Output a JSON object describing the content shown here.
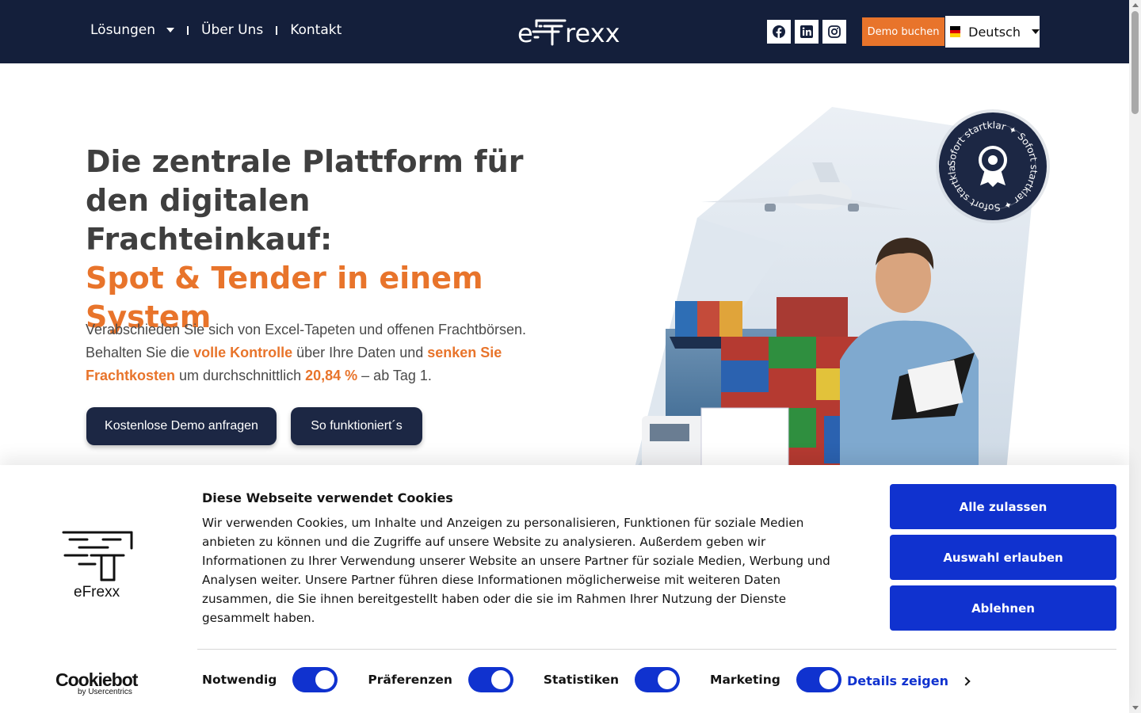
{
  "header": {
    "nav": [
      {
        "label": "Lösungen",
        "has_dropdown": true
      },
      {
        "label": "Über Uns"
      },
      {
        "label": "Kontakt"
      }
    ],
    "logo_text": "eFrexx",
    "socials": [
      "facebook-icon",
      "linkedin-icon",
      "instagram-icon"
    ],
    "demo_button": "Demo buchen",
    "language": {
      "label": "Deutsch",
      "flag": "de-flag"
    }
  },
  "hero": {
    "title_line1": "Die zentrale Plattform für den digitalen Frachteinkauf:",
    "title_accent": "Spot & Tender in einem System",
    "text_1": "Verabschieden Sie sich von Excel-Tapeten und offenen Frachtbörsen. Behalten Sie die ",
    "hl_1": "volle Kontrolle",
    "text_2": " über Ihre Daten und ",
    "hl_2": "senken Sie Frachtkosten",
    "text_3": " um durchschnittlich ",
    "hl_3": "20,84 %",
    "text_4": " – ab Tag 1.",
    "btn_demo": "Kostenlose Demo anfragen",
    "btn_how": "So funktioniert´s",
    "badge_text": "Sofort startklar ✦ Sofort startklar ✦ Sofort startklar ✦"
  },
  "cookie": {
    "logo_text": "eFrexx",
    "title": "Diese Webseite verwendet Cookies",
    "body": "Wir verwenden Cookies, um Inhalte und Anzeigen zu personalisieren, Funktionen für soziale Medien anbieten zu können und die Zugriffe auf unsere Website zu analysieren. Außerdem geben wir Informationen zu Ihrer Verwendung unserer Website an unsere Partner für soziale Medien, Werbung und Analysen weiter. Unsere Partner führen diese Informationen möglicherweise mit weiteren Daten zusammen, die Sie ihnen bereitgestellt haben oder die sie im Rahmen Ihrer Nutzung der Dienste gesammelt haben.",
    "btn_allow_all": "Alle zulassen",
    "btn_allow_selection": "Auswahl erlauben",
    "btn_deny": "Ablehnen",
    "toggles": [
      {
        "label": "Notwendig",
        "on": true
      },
      {
        "label": "Präferenzen",
        "on": true
      },
      {
        "label": "Statistiken",
        "on": true
      },
      {
        "label": "Marketing",
        "on": true
      }
    ],
    "details": "Details zeigen",
    "cookiebot": "Cookiebot",
    "cookiebot_sub": "by Usercentrics"
  },
  "colors": {
    "navy": "#141f3b",
    "orange": "#e8742b",
    "cookie_blue": "#1032cf"
  }
}
